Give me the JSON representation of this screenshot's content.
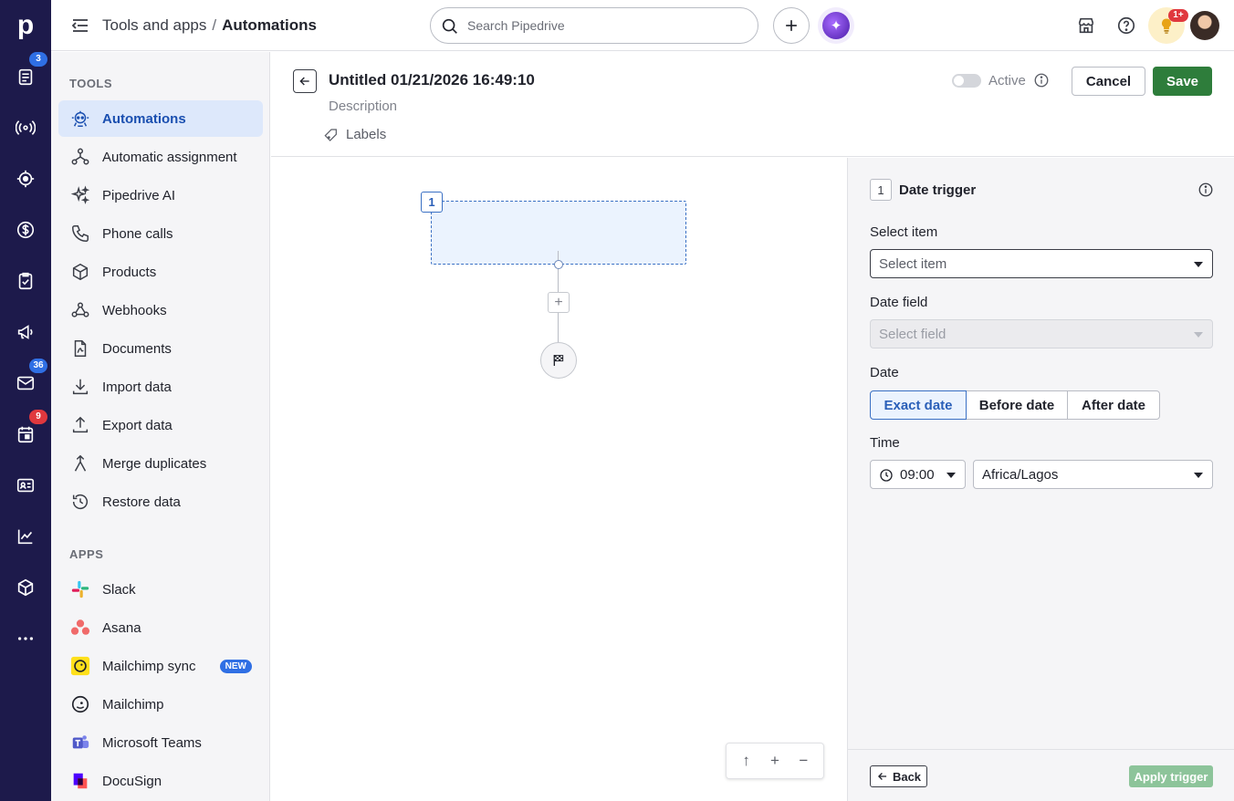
{
  "app": {
    "logo": "p",
    "accent_color": "#2f6fe4",
    "rail_color": "#1d1a4b",
    "save_color": "#2e7d3b"
  },
  "rail": {
    "badges": {
      "leads": "3",
      "mail": "36",
      "calendar": "9"
    }
  },
  "topbar": {
    "breadcrumb_parent": "Tools and apps",
    "breadcrumb_separator": "/",
    "breadcrumb_current": "Automations",
    "search_placeholder": "Search Pipedrive",
    "tips_badge": "1+"
  },
  "sidebar": {
    "tools_title": "TOOLS",
    "tools": [
      {
        "label": "Automations",
        "icon": "robot-icon",
        "active": true
      },
      {
        "label": "Automatic assignment",
        "icon": "assignment-icon"
      },
      {
        "label": "Pipedrive AI",
        "icon": "sparkle-icon"
      },
      {
        "label": "Phone calls",
        "icon": "phone-icon"
      },
      {
        "label": "Products",
        "icon": "box-icon"
      },
      {
        "label": "Webhooks",
        "icon": "webhook-icon"
      },
      {
        "label": "Documents",
        "icon": "document-icon"
      },
      {
        "label": "Import data",
        "icon": "import-icon"
      },
      {
        "label": "Export data",
        "icon": "export-icon"
      },
      {
        "label": "Merge duplicates",
        "icon": "merge-icon"
      },
      {
        "label": "Restore data",
        "icon": "restore-icon"
      }
    ],
    "apps_title": "APPS",
    "apps": [
      {
        "label": "Slack",
        "icon": "slack-icon"
      },
      {
        "label": "Asana",
        "icon": "asana-icon"
      },
      {
        "label": "Mailchimp sync",
        "icon": "mailchimp-icon",
        "badge": "NEW"
      },
      {
        "label": "Mailchimp",
        "icon": "mailchimp-icon"
      },
      {
        "label": "Microsoft Teams",
        "icon": "teams-icon"
      },
      {
        "label": "DocuSign",
        "icon": "docusign-icon"
      }
    ]
  },
  "automation": {
    "title": "Untitled 01/21/2026 16:49:10",
    "description_placeholder": "Description",
    "labels": "Labels",
    "active_label": "Active",
    "cancel": "Cancel",
    "save": "Save"
  },
  "canvas": {
    "node_number": "1",
    "add_step": "+",
    "zoom": {
      "up": "↑",
      "in": "+",
      "out": "−"
    }
  },
  "panel": {
    "step_number": "1",
    "step_title": "Date trigger",
    "select_item_label": "Select item",
    "select_item_placeholder": "Select item",
    "date_field_label": "Date field",
    "date_field_placeholder": "Select field",
    "date_label": "Date",
    "date_options": [
      "Exact date",
      "Before date",
      "After date"
    ],
    "date_selected": "Exact date",
    "time_label": "Time",
    "time_value": "09:00",
    "timezone_value": "Africa/Lagos",
    "back": "Back",
    "apply": "Apply trigger"
  }
}
